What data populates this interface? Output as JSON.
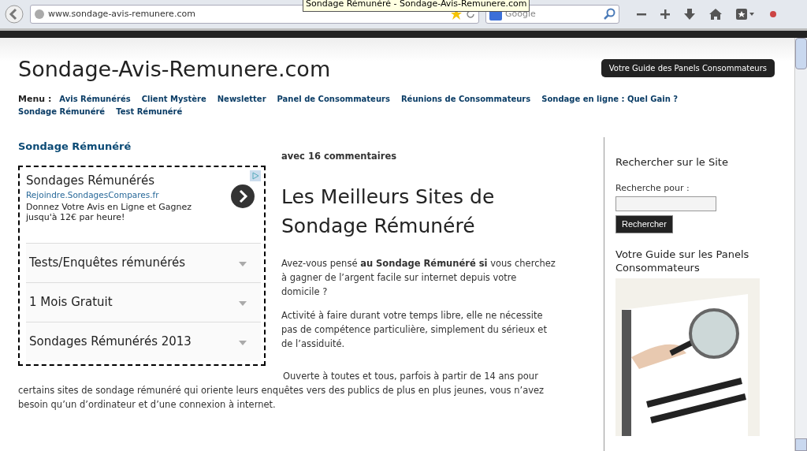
{
  "browser": {
    "url": "www.sondage-avis-remunere.com",
    "tooltip": "Sondage Rémunéré - Sondage-Avis-Remunere.com",
    "search_placeholder": "Google"
  },
  "site": {
    "title": "Sondage-Avis-Remunere.com",
    "tagline": "Votre Guide des Panels Consommateurs"
  },
  "menu": {
    "label": "Menu :",
    "items": [
      {
        "label": "Avis Rémunérés"
      },
      {
        "label": "Client Mystère"
      },
      {
        "label": "Newsletter"
      },
      {
        "label": "Panel de Consommateurs"
      },
      {
        "label": "Réunions de Consommateurs"
      },
      {
        "label": "Sondage en ligne : Quel Gain ?"
      },
      {
        "label": "Sondage Rémunéré"
      },
      {
        "label": "Test Rémunéré"
      }
    ]
  },
  "breadcrumb": "Sondage Rémunéré",
  "ad": {
    "title": "Sondages Rémunérés",
    "url": "Rejoindre.SondagesCompares.fr",
    "text": "Donnez Votre Avis en Ligne et Gagnez jusqu'à 12€ par heure!",
    "links": [
      "Tests/Enquêtes rémunérés",
      "1 Mois Gratuit",
      "Sondages Rémunérés 2013"
    ]
  },
  "article": {
    "comments": "avec 16 commentaires",
    "title": "Les Meilleurs Sites de Sondage Rémunéré",
    "paragraphs": [
      "Avez-vous pensé **au Sondage Rémunéré si** vous cherchez à gagner de l’argent facile sur internet depuis votre domicile ?",
      "Activité à faire durant votre temps libre, elle ne nécessite pas de compétence particulière, simplement du sérieux et de l’assiduité.",
      "Ouverte à toutes et tous, parfois à partir de 14 ans pour certains sites de sondage rémunéré qui oriente leurs enquêtes vers des publics de plus en plus jeunes, vous n’avez besoin qu’un d’ordinateur et d’une connexion à internet."
    ]
  },
  "sidebar": {
    "search_heading": "Rechercher sur le Site",
    "search_label": "Recherche pour :",
    "search_button": "Rechercher",
    "guide_heading": "Votre Guide sur les Panels Consommateurs"
  }
}
